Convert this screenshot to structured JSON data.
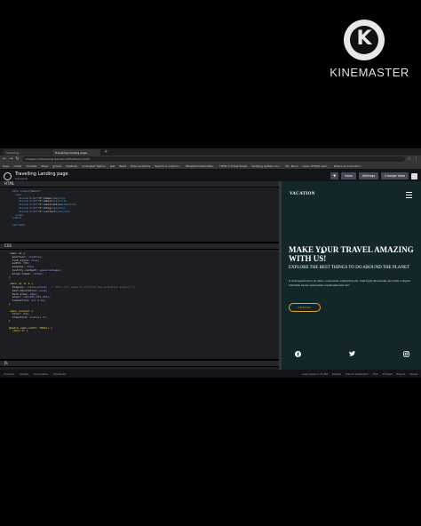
{
  "watermark": {
    "brand": "KINEMASTER",
    "logo_letter": "K"
  },
  "browser": {
    "tabs": [
      {
        "label": "Travelling",
        "active": false
      },
      {
        "label": "Travelling Landing page",
        "active": true
      }
    ],
    "new_tab_icon": "plus-icon",
    "url": "codepen.io/travelmkr/pen/abcdef?editors=1100",
    "bookmarks": [
      "Apps",
      "Gmail",
      "YouTube",
      "Maps",
      "gmails",
      "SkyBoop",
      "Codingbar Python",
      "Jest",
      "Blast",
      "Shan Academy",
      "Search to Code fo...",
      "FalseInformation8ea...",
      "HTML 5 Cheat Sheet",
      "Verifying System Qu...",
      "Nt - Mock",
      "Learn HTML5 Gam...",
      "Basics of ActionScri..."
    ]
  },
  "codepen": {
    "title": "Travelling Landing page",
    "author": "travelmkr",
    "buttons": {
      "save": "Save",
      "settings": "Settings",
      "change_view": "Change View"
    }
  },
  "editors": {
    "html_label": "HTML",
    "css_label": "CSS",
    "js_label": "JS"
  },
  "preview": {
    "brand": "VACATION",
    "headline": "MAKE YOUR TRAVEL AMAZING WITH US!",
    "subheadline": "EXPLORE THE BEST THINGS TO DO AROUND THE PLANET",
    "paragraph": "Lorem ipsum dolor sit amet, consectetur adipisicing elit. Sunt fugit laboriosam quo nulla voluptas blanditiis beatae perferendis repellendus fuit hic!",
    "button": "TRAVEL",
    "socials": [
      "facebook-icon",
      "twitter-icon",
      "instagram-icon"
    ]
  },
  "statusbar": {
    "left": [
      "Console",
      "Assets",
      "Comments",
      "Shortcuts"
    ],
    "right": [
      "Last saved 2:15 PM",
      "Delete",
      "Add to Collection",
      "Fork",
      "Embed",
      "Export",
      "Share"
    ]
  }
}
